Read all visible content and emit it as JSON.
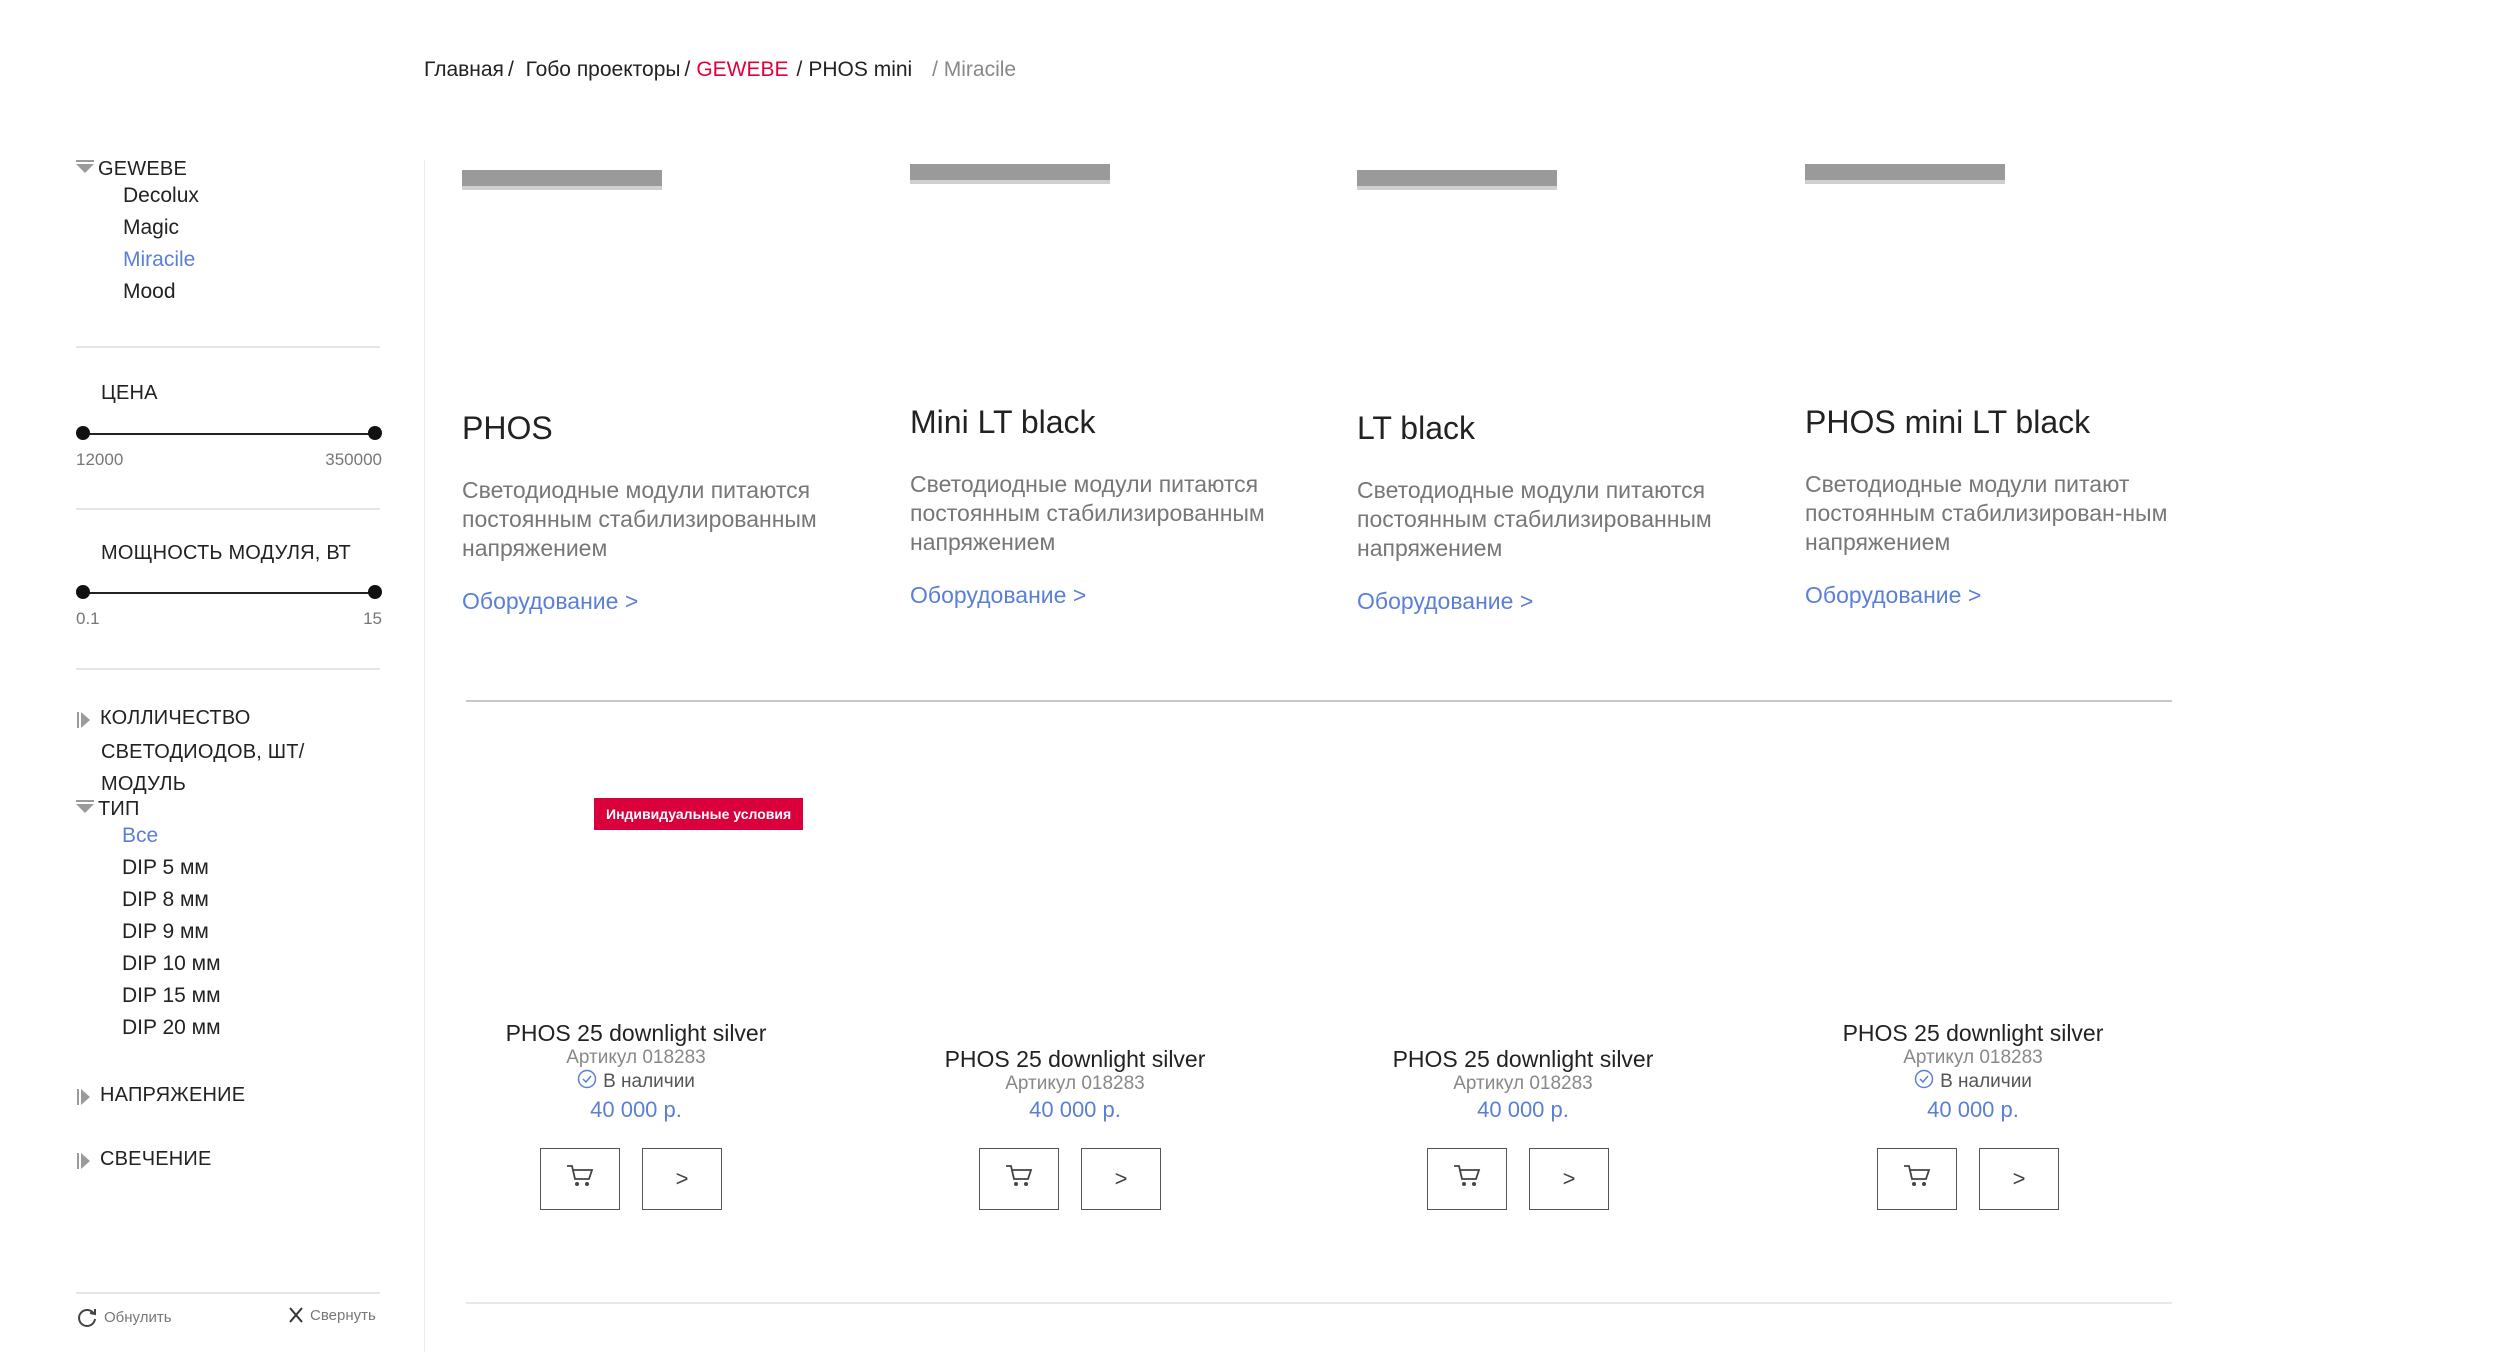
{
  "breadcrumb": {
    "home": "Главная",
    "category": "Гобо проекторы",
    "brand": "GEWEBE",
    "series": "PHOS mini",
    "current": "/ Miracile",
    "sep": "/"
  },
  "sidebar": {
    "brand_group": {
      "title": "GEWEBE",
      "items": [
        {
          "label": "Decolux",
          "active": false
        },
        {
          "label": "Magic",
          "active": false
        },
        {
          "label": "Miracile",
          "active": true
        },
        {
          "label": "Mood",
          "active": false
        }
      ]
    },
    "price": {
      "title": "ЦЕНА",
      "min": "12000",
      "max": "350000"
    },
    "power": {
      "title": "МОЩНОСТЬ МОДУЛЯ, ВТ",
      "min": "0.1",
      "max": "15"
    },
    "led_count": {
      "title_line1": "КОЛЛИЧЕСТВО",
      "title_line2": "СВЕТОДИОДОВ, ШТ/МОДУЛЬ"
    },
    "type": {
      "title": "ТИП",
      "items": [
        {
          "label": "Все",
          "active": true
        },
        {
          "label": "DIP 5 мм",
          "active": false
        },
        {
          "label": "DIP 8 мм",
          "active": false
        },
        {
          "label": "DIP 9 мм",
          "active": false
        },
        {
          "label": "DIP 10 мм",
          "active": false
        },
        {
          "label": "DIP 15 мм",
          "active": false
        },
        {
          "label": "DIP 20 мм",
          "active": false
        }
      ]
    },
    "voltage": {
      "title": "НАПРЯЖЕНИЕ"
    },
    "glow": {
      "title": "СВЕЧЕНИЕ"
    },
    "reset_label": "Обнулить",
    "collapse_label": "Свернуть"
  },
  "top_products": [
    {
      "title": "PHOS",
      "desc": "Светодиодные модули питаются постоянным стабилизированным напряжением",
      "link": "Оборудование >",
      "color": "black"
    },
    {
      "title": "Mini LT black",
      "desc": "Светодиодные модули питаются постоянным стабилизированным напряжением",
      "link": "Оборудование >",
      "color": "white"
    },
    {
      "title": "LT black",
      "desc": "Светодиодные модули питаются постоянным стабилизированным напряжением",
      "link": "Оборудование >",
      "color": "black"
    },
    {
      "title": "PHOS mini LT black",
      "desc": "Светодиодные модули питают постоянным стабилизирован-ным напряжением",
      "link": "Оборудование >",
      "color": "white"
    }
  ],
  "products": [
    {
      "name": "PHOS 25 downlight silver",
      "article": "Артикул 018283",
      "stock": "В наличии",
      "price": "40 000 р.",
      "badge": "Индивидуальные условия",
      "ring": "silver"
    },
    {
      "name": "PHOS 25 downlight silver",
      "article": "Артикул 018283",
      "stock": "",
      "price": "40 000 р.",
      "badge": "",
      "ring": "black"
    },
    {
      "name": "PHOS 25 downlight silver",
      "article": "Артикул 018283",
      "stock": "",
      "price": "40 000 р.",
      "badge": "",
      "ring": "silver"
    },
    {
      "name": "PHOS 25 downlight silver",
      "article": "Артикул 018283",
      "stock": "В наличии",
      "price": "40 000 р.",
      "badge": "",
      "ring": "silver"
    }
  ],
  "buttons": {
    "next_label": ">"
  },
  "colors": {
    "accent": "#5b7fd6",
    "brand_red": "#e0003c"
  }
}
